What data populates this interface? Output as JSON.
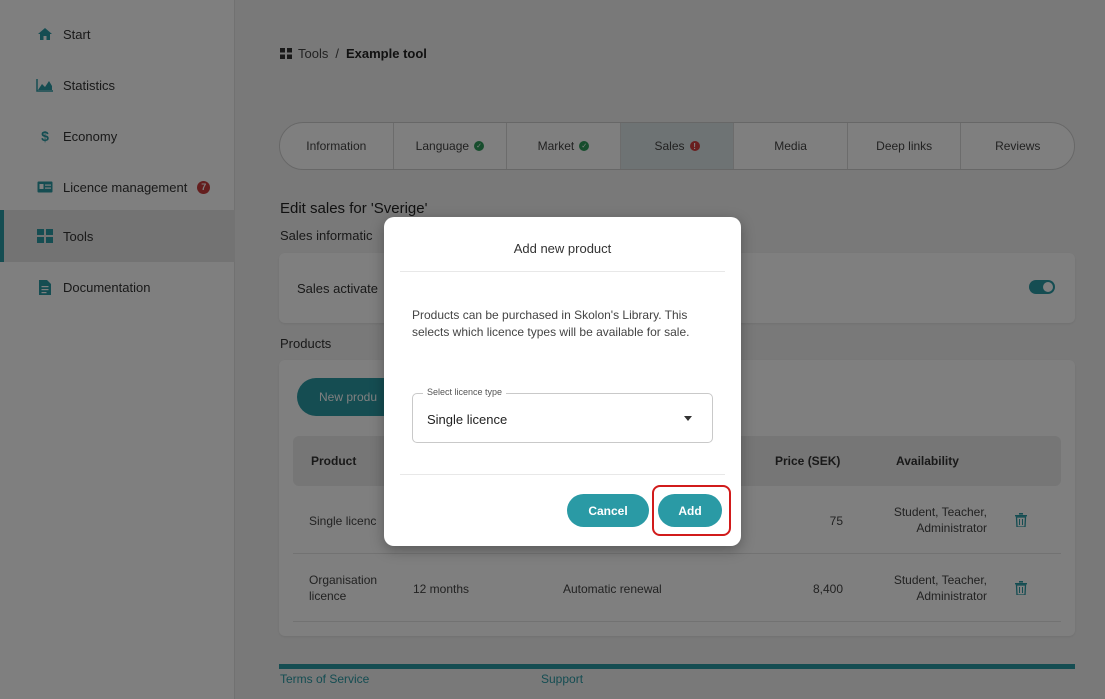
{
  "colors": {
    "accent": "#2a9aa5",
    "error": "#d23c3c",
    "ok": "#2f9a5a"
  },
  "sidebar": {
    "items": [
      {
        "icon": "home-icon",
        "label": "Start"
      },
      {
        "icon": "chart-icon",
        "label": "Statistics"
      },
      {
        "icon": "dollar-icon",
        "label": "Economy"
      },
      {
        "icon": "id-card-icon",
        "label": "Licence management",
        "badge": "7"
      },
      {
        "icon": "grid-icon",
        "label": "Tools",
        "active": true
      },
      {
        "icon": "document-icon",
        "label": "Documentation"
      }
    ]
  },
  "breadcrumb": {
    "parent": "Tools",
    "separator": "/",
    "current": "Example tool"
  },
  "tabs": [
    {
      "label": "Information"
    },
    {
      "label": "Language",
      "status": "ok"
    },
    {
      "label": "Market",
      "status": "ok"
    },
    {
      "label": "Sales",
      "status": "error",
      "active": true
    },
    {
      "label": "Media"
    },
    {
      "label": "Deep links"
    },
    {
      "label": "Reviews"
    }
  ],
  "edit_title": "Edit sales for 'Sverige'",
  "sales_info_title": "Sales informatic",
  "sales_activated_label": "Sales activate",
  "sales_activated": true,
  "products": {
    "title": "Products",
    "new_button": "New produ",
    "columns": [
      "Product",
      "Price (SEK)",
      "Availability"
    ],
    "rows": [
      {
        "product": "Single licenc",
        "period": "",
        "renewal": "",
        "price": "75",
        "availability_line1": "Student, Teacher,",
        "availability_line2": "Administrator"
      },
      {
        "product_line1": "Organisation",
        "product_line2": "licence",
        "period": "12 months",
        "renewal": "Automatic renewal",
        "price": "8,400",
        "availability_line1": "Student, Teacher,",
        "availability_line2": "Administrator"
      }
    ]
  },
  "footer": {
    "terms": "Terms of Service",
    "support": "Support"
  },
  "modal": {
    "title": "Add new product",
    "text": "Products can be purchased in Skolon's Library. This selects which licence types will be available for sale.",
    "select_label": "Select licence type",
    "select_value": "Single licence",
    "cancel": "Cancel",
    "add": "Add"
  }
}
